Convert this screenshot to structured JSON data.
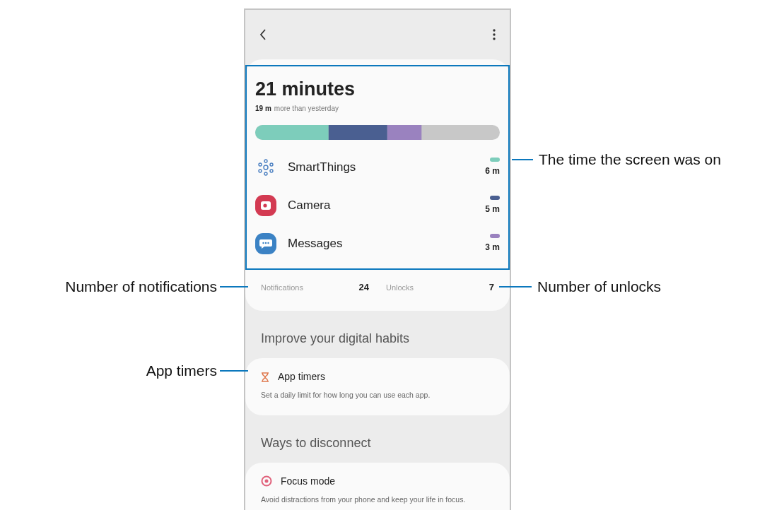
{
  "summary": {
    "total": "21 minutes",
    "delta_bold": "19 m",
    "delta_text": "more than yesterday"
  },
  "apps": [
    {
      "name": "SmartThings",
      "time": "6 m",
      "color": "#7dcdbb",
      "kind": "smartthings"
    },
    {
      "name": "Camera",
      "time": "5 m",
      "color": "#4a5f91",
      "kind": "camera"
    },
    {
      "name": "Messages",
      "time": "3 m",
      "color": "#9a82bf",
      "kind": "messages"
    }
  ],
  "stats": [
    {
      "label": "Notifications",
      "value": "24"
    },
    {
      "label": "Unlocks",
      "value": "7"
    }
  ],
  "sections": [
    {
      "title": "Improve your digital habits",
      "card": {
        "kind": "timer",
        "title": "App timers",
        "description": "Set a daily limit for how long you can use each app."
      }
    },
    {
      "title": "Ways to disconnect",
      "card": {
        "kind": "focus",
        "title": "Focus mode",
        "description": "Avoid distractions from your phone and keep your life in focus."
      }
    }
  ],
  "callouts_left": [
    {
      "label": "Number of notifications"
    },
    {
      "label": "App timers"
    }
  ],
  "callouts_right": [
    {
      "label": "The time the screen was on"
    },
    {
      "label": "Number of unlocks"
    }
  ]
}
